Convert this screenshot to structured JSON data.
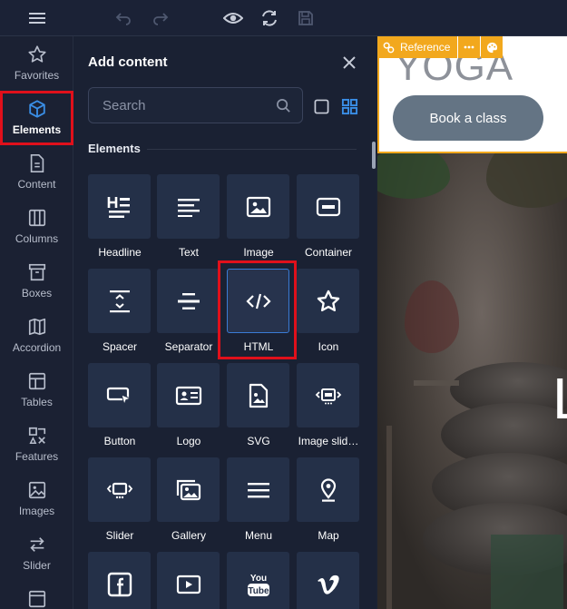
{
  "toolbar": {
    "icons": [
      "menu-icon",
      "undo-icon",
      "redo-icon",
      "preview-eye-icon",
      "refresh-icon",
      "save-icon"
    ]
  },
  "rail": {
    "items": [
      {
        "label": "Favorites",
        "icon": "star-icon"
      },
      {
        "label": "Elements",
        "icon": "cube-icon",
        "active": true
      },
      {
        "label": "Content",
        "icon": "document-icon"
      },
      {
        "label": "Columns",
        "icon": "columns-icon"
      },
      {
        "label": "Boxes",
        "icon": "box-icon"
      },
      {
        "label": "Accordion",
        "icon": "map-fold-icon"
      },
      {
        "label": "Tables",
        "icon": "table-icon"
      },
      {
        "label": "Features",
        "icon": "features-icon"
      },
      {
        "label": "Images",
        "icon": "image-icon"
      },
      {
        "label": "Slider",
        "icon": "arrows-swap-icon"
      }
    ]
  },
  "panel": {
    "title": "Add content",
    "search_placeholder": "Search",
    "section_label": "Elements",
    "tiles": [
      {
        "label": "Headline",
        "icon": "headline-icon"
      },
      {
        "label": "Text",
        "icon": "text-lines-icon"
      },
      {
        "label": "Image",
        "icon": "image-icon"
      },
      {
        "label": "Container",
        "icon": "container-icon"
      },
      {
        "label": "Spacer",
        "icon": "spacer-icon"
      },
      {
        "label": "Separator",
        "icon": "separator-icon"
      },
      {
        "label": "HTML",
        "icon": "code-icon",
        "selected": true
      },
      {
        "label": "Icon",
        "icon": "star-icon"
      },
      {
        "label": "Button",
        "icon": "button-cursor-icon"
      },
      {
        "label": "Logo",
        "icon": "logo-card-icon"
      },
      {
        "label": "SVG",
        "icon": "svg-file-icon"
      },
      {
        "label": "Image slid…",
        "icon": "image-slider-icon"
      },
      {
        "label": "Slider",
        "icon": "slider-icon"
      },
      {
        "label": "Gallery",
        "icon": "gallery-icon"
      },
      {
        "label": "Menu",
        "icon": "menu-icon"
      },
      {
        "label": "Map",
        "icon": "map-pin-icon"
      },
      {
        "label": "",
        "icon": "facebook-icon"
      },
      {
        "label": "",
        "icon": "play-video-icon"
      },
      {
        "label": "",
        "icon": "youtube-icon"
      },
      {
        "label": "",
        "icon": "vimeo-icon"
      }
    ]
  },
  "canvas": {
    "reference_label": "Reference",
    "logo_text": "YOGA",
    "button_label": "Book a class",
    "hero_letter": "L"
  },
  "colors": {
    "accent": "#3a7bd5",
    "highlight": "#e0101b",
    "selection_bar": "#f2a81d",
    "panel_bg": "#1a2133",
    "tile_bg": "#243048"
  }
}
